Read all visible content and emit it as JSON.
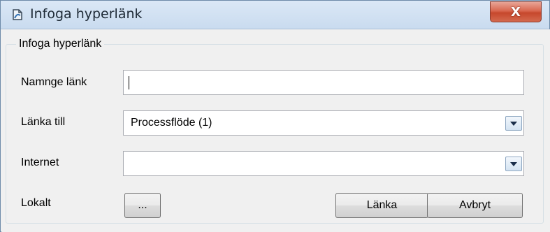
{
  "window": {
    "title": "Infoga hyperlänk",
    "close_glyph": "X"
  },
  "group": {
    "legend": "Infoga hyperlänk"
  },
  "form": {
    "name": {
      "label": "Namnge länk",
      "value": ""
    },
    "link_to": {
      "label": "Länka till",
      "value": "Processflöde (1)"
    },
    "internet": {
      "label": "Internet",
      "value": ""
    },
    "local": {
      "label": "Lokalt",
      "browse_label": "..."
    }
  },
  "buttons": {
    "link": "Länka",
    "cancel": "Avbryt"
  },
  "icons": {
    "app": "hyperlink-icon",
    "dropdown": "dropdown-arrow-icon",
    "close": "close-icon"
  },
  "colors": {
    "title_bar": "#c9dbef",
    "close_button": "#c6472c",
    "dropdown_arrow": "#1a2e4a"
  }
}
